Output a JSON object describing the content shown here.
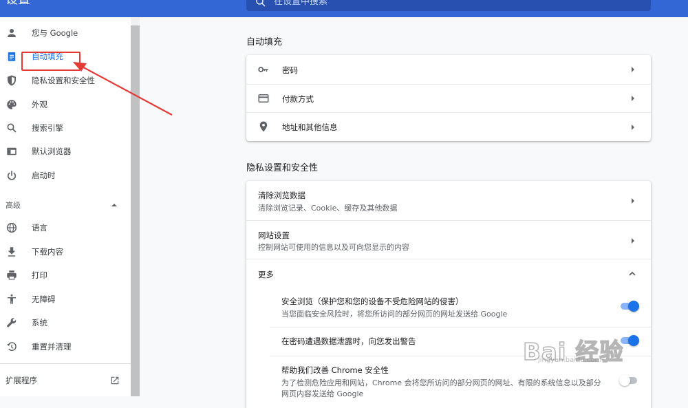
{
  "header": {
    "title": "设置",
    "search_placeholder": "在设置中搜索"
  },
  "sidebar": {
    "items": [
      {
        "label": "您与 Google",
        "icon": "person-icon"
      },
      {
        "label": "自动填充",
        "icon": "assignment-icon"
      },
      {
        "label": "隐私设置和安全性",
        "icon": "shield-icon"
      },
      {
        "label": "外观",
        "icon": "palette-icon"
      },
      {
        "label": "搜索引擎",
        "icon": "search-icon"
      },
      {
        "label": "默认浏览器",
        "icon": "browser-icon"
      },
      {
        "label": "启动时",
        "icon": "power-icon"
      }
    ],
    "advanced_label": "高级",
    "advanced_items": [
      {
        "label": "语言",
        "icon": "globe-icon"
      },
      {
        "label": "下载内容",
        "icon": "download-icon"
      },
      {
        "label": "打印",
        "icon": "print-icon"
      },
      {
        "label": "无障碍",
        "icon": "accessibility-icon"
      },
      {
        "label": "系统",
        "icon": "wrench-icon"
      },
      {
        "label": "重置并清理",
        "icon": "restore-icon"
      }
    ],
    "extensions_label": "扩展程序"
  },
  "autofill": {
    "title": "自动填充",
    "rows": [
      {
        "label": "密码",
        "icon": "key-icon"
      },
      {
        "label": "付款方式",
        "icon": "credit-card-icon"
      },
      {
        "label": "地址和其他信息",
        "icon": "location-pin-icon"
      }
    ]
  },
  "privacy": {
    "title": "隐私设置和安全性",
    "clear_title": "清除浏览数据",
    "clear_sub": "清除浏览记录、Cookie、缓存及其他数据",
    "site_title": "网站设置",
    "site_sub": "控制网站可使用的信息以及可向您显示的内容",
    "more_label": "更多",
    "safe_title": "安全浏览（保护您和您的设备不受危险网站的侵害）",
    "safe_sub": "当您面临安全风险时，将您所访问的部分网页的网址发送给 Google",
    "safe_on": true,
    "leak_title": "在密码遭遇数据泄露时，向您发出警告",
    "leak_on": true,
    "improve_title": "帮助我们改善 Chrome 安全性",
    "improve_sub1": "为了检测危险应用和网站，Chrome 会将您所访问的部分网页的网址、有限的系统信息以及部分",
    "improve_sub2": "网页内容发送给 Google",
    "improve_on": false
  },
  "watermark": {
    "text": "Bai 经验",
    "sub": "jingyan.baidu.com"
  },
  "colors": {
    "accent": "#1a73e8",
    "header": "#3367d6",
    "annotation": "#e53935"
  }
}
